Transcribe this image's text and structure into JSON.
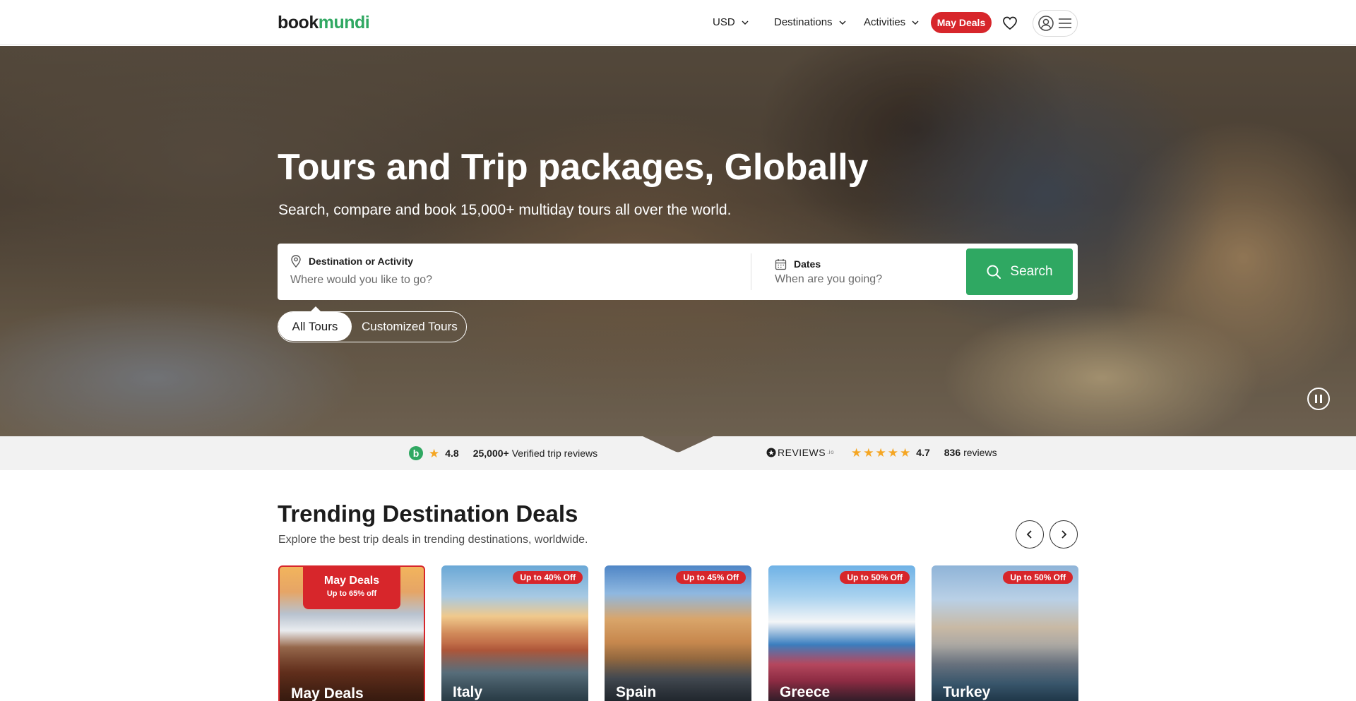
{
  "header": {
    "logo_part1": "book",
    "logo_part2": "mundi",
    "currency": "USD",
    "nav_destinations": "Destinations",
    "nav_activities": "Activities",
    "may_deals": "May Deals"
  },
  "hero": {
    "title": "Tours and Trip packages, Globally",
    "subtitle": "Search, compare and book 15,000+ multiday tours all over the world.",
    "destination_label": "Destination or Activity",
    "destination_placeholder": "Where would you like to go?",
    "dates_label": "Dates",
    "dates_placeholder": "When are you going?",
    "search_button": "Search",
    "tab_all": "All Tours",
    "tab_custom": "Customized Tours"
  },
  "reviews": {
    "b_letter": "b",
    "bookmundi_rating": "4.8",
    "bookmundi_count": "25,000+",
    "bookmundi_text": "Verified trip reviews",
    "reviews_io_logo": "REVIEWS",
    "reviews_io_suffix": ".io",
    "reviews_io_rating": "4.7",
    "reviews_io_count": "836",
    "reviews_io_text": "reviews"
  },
  "trending": {
    "title": "Trending Destination Deals",
    "subtitle": "Explore the best trip deals in trending destinations, worldwide.",
    "cards": [
      {
        "name": "May Deals",
        "badge_title": "May Deals",
        "badge_sub": "Up to 65% off"
      },
      {
        "name": "Italy",
        "badge": "Up to 40% Off"
      },
      {
        "name": "Spain",
        "badge": "Up to 45% Off"
      },
      {
        "name": "Greece",
        "badge": "Up to 50% Off"
      },
      {
        "name": "Turkey",
        "badge": "Up to 50% Off"
      }
    ]
  },
  "colors": {
    "brand_green": "#30a862",
    "deal_red": "#d7262b",
    "star": "#f5a623"
  }
}
